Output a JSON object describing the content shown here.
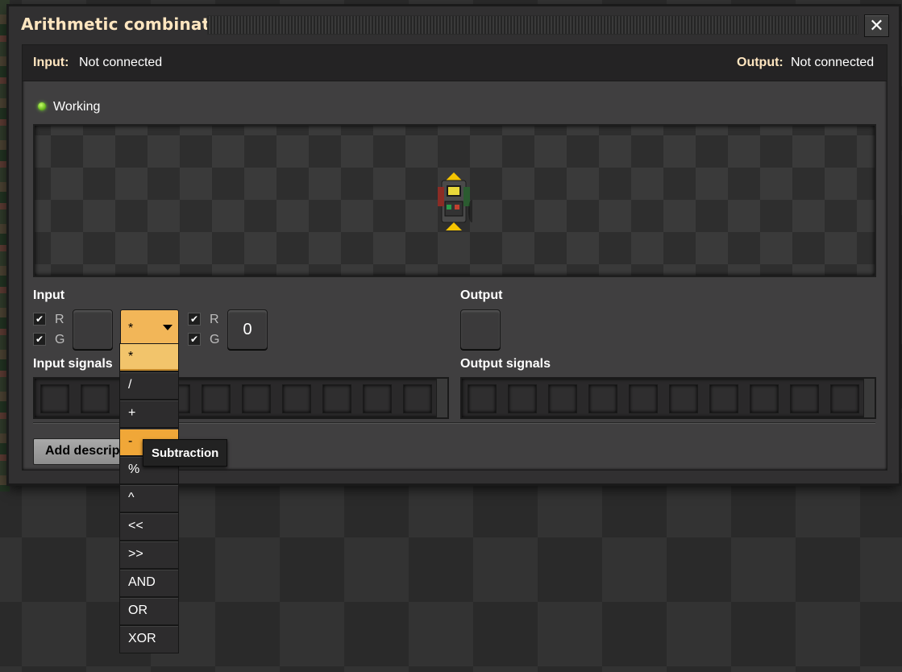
{
  "window": {
    "title": "Arithmetic combinator",
    "close_symbol": "✕"
  },
  "connection": {
    "input_label": "Input:",
    "input_value": "Not connected",
    "output_label": "Output:",
    "output_value": "Not connected"
  },
  "status": {
    "text": "Working",
    "color": "#7ad83a"
  },
  "input_section": {
    "title": "Input",
    "left_checks": [
      {
        "label": "R",
        "checked": true
      },
      {
        "label": "G",
        "checked": true
      }
    ],
    "right_checks": [
      {
        "label": "R",
        "checked": true
      },
      {
        "label": "G",
        "checked": true
      }
    ],
    "operator_selected": "*",
    "constant_value": "0",
    "signals_title": "Input signals"
  },
  "output_section": {
    "title": "Output",
    "signals_title": "Output signals"
  },
  "description_button": "Add description",
  "operator_list": {
    "items": [
      "*",
      "/",
      "+",
      "-",
      "%",
      "^",
      "<<",
      ">>",
      "AND",
      "OR",
      "XOR"
    ],
    "selected": "*",
    "hovered": "-"
  },
  "tooltip": "Subtraction",
  "colors": {
    "accent": "#f2b658",
    "title": "#ffe6c0",
    "panel": "#403f40"
  }
}
